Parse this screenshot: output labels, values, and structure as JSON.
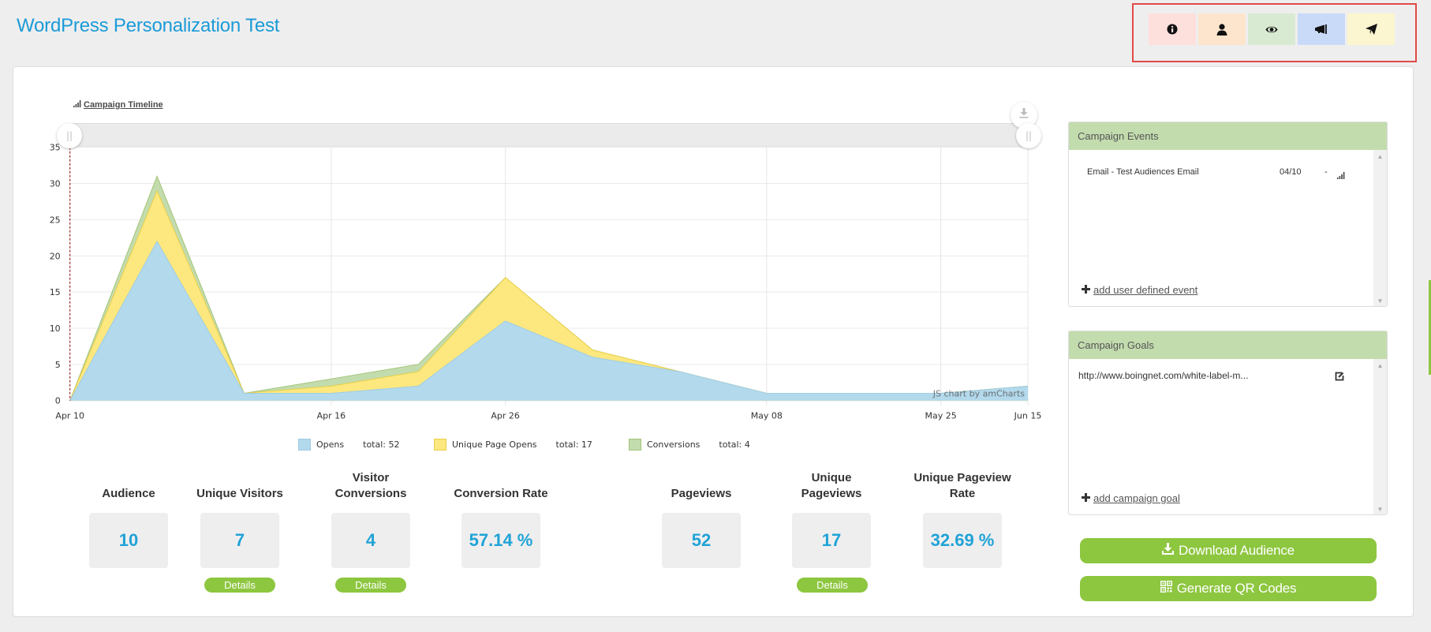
{
  "page": {
    "title": "WordPress Personalization Test"
  },
  "colors": {
    "accent": "#1a9bd7",
    "value_text": "#1fa3d6",
    "button_green": "#8dc63f",
    "panel_header": "#c3dcae",
    "highlight_border": "#e04a45"
  },
  "toolbar": {
    "buttons": [
      {
        "name": "info",
        "icon": "info-circle-icon",
        "bg": "#fde0dc"
      },
      {
        "name": "audience",
        "icon": "user-icon",
        "bg": "#fde5cd"
      },
      {
        "name": "view",
        "icon": "eye-icon",
        "bg": "#d9ead3"
      },
      {
        "name": "campaign",
        "icon": "bullhorn-icon",
        "bg": "#c9daf8"
      },
      {
        "name": "send",
        "icon": "paper-plane-icon",
        "bg": "#fbf6cf"
      }
    ]
  },
  "chart_section": {
    "link_label": "Campaign Timeline",
    "link_icon": "bar-chart-icon",
    "credit": "JS chart by amCharts",
    "export_icon": "download-icon",
    "scroller_handle_glyph": "||"
  },
  "chart_data": {
    "type": "area",
    "stacked": true,
    "title": "",
    "xlabel": "",
    "ylabel": "",
    "categories": [
      "Apr 10",
      "",
      "",
      "Apr 16",
      "",
      "Apr 26",
      "",
      "",
      "May 08",
      "",
      "May 25",
      "Jun 15"
    ],
    "ylim": [
      0,
      35
    ],
    "yticks": [
      0,
      5,
      10,
      15,
      20,
      25,
      30,
      35
    ],
    "grid": true,
    "legend_position": "bottom",
    "series": [
      {
        "name": "Opens",
        "total": 52,
        "total_text": "total: 52",
        "color": "#b3d9ec",
        "stroke": "#9fcce3",
        "values": [
          0,
          22,
          1,
          1,
          2,
          11,
          6,
          4,
          1,
          1,
          1,
          2
        ]
      },
      {
        "name": "Unique Page Opens",
        "total": 17,
        "total_text": "total: 17",
        "color": "#fde87f",
        "stroke": "#e8cf4a",
        "values": [
          0,
          7,
          0,
          1,
          2,
          6,
          1,
          0,
          0,
          0,
          0,
          0
        ]
      },
      {
        "name": "Conversions",
        "total": 4,
        "total_text": "total: 4",
        "color": "#c3dcae",
        "stroke": "#a3c47a",
        "values": [
          0,
          2,
          0,
          1,
          1,
          0,
          0,
          0,
          0,
          0,
          0,
          0
        ]
      }
    ]
  },
  "stats": [
    {
      "label": "Audience",
      "value": "10"
    },
    {
      "label": "Unique Visitors",
      "value": "7",
      "details": "Details"
    },
    {
      "label": "Visitor\nConversions",
      "value": "4",
      "details": "Details"
    },
    {
      "label": "Conversion Rate",
      "value": "57.14 %"
    },
    {
      "label": "Pageviews",
      "value": "52"
    },
    {
      "label": "Unique\nPageviews",
      "value": "17",
      "details": "Details"
    },
    {
      "label": "Unique Pageview\nRate",
      "value": "32.69 %"
    }
  ],
  "events_panel": {
    "title": "Campaign Events",
    "items": [
      {
        "name": "Email - Test Audiences Email",
        "date": "04/10",
        "end": "-",
        "icon": "bar-chart-icon"
      }
    ],
    "add_label": "add user defined event"
  },
  "goals_panel": {
    "title": "Campaign Goals",
    "items": [
      {
        "url": "http://www.boingnet.com/white-label-m...",
        "icon": "edit-icon"
      }
    ],
    "add_label": "add campaign goal"
  },
  "actions": {
    "download_label": "Download Audience",
    "qr_label": "Generate QR Codes"
  },
  "scroll_arrows": {
    "up": "▲",
    "down": "▼"
  }
}
